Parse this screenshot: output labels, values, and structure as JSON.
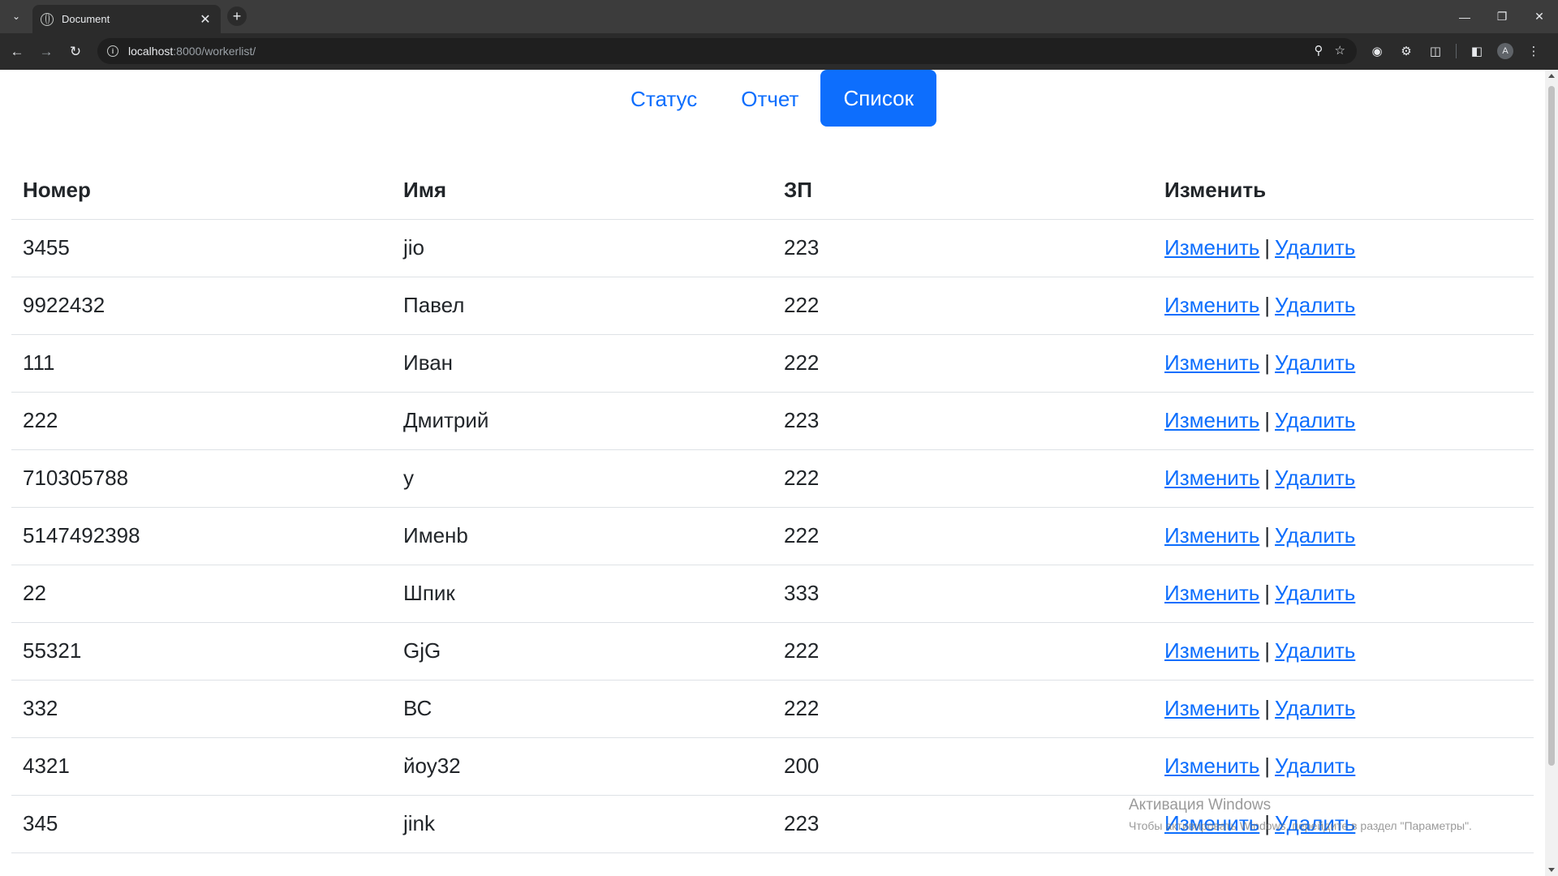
{
  "browser": {
    "tab_title": "Document",
    "url_host": "localhost",
    "url_rest": ":8000/workerlist/",
    "profile_initial": "A"
  },
  "nav": {
    "items": [
      {
        "label": "Статус",
        "active": false
      },
      {
        "label": "Отчет",
        "active": false
      },
      {
        "label": "Список",
        "active": true
      }
    ]
  },
  "table": {
    "headers": [
      "Номер",
      "Имя",
      "ЗП",
      "Изменить"
    ],
    "edit_label": "Изменить",
    "delete_label": "Удалить",
    "separator": "|",
    "rows": [
      {
        "id": "3455",
        "name": "jio",
        "salary": "223"
      },
      {
        "id": "9922432",
        "name": "Павел",
        "salary": "222"
      },
      {
        "id": "111",
        "name": "Иван",
        "salary": "222"
      },
      {
        "id": "222",
        "name": "Дмитрий",
        "salary": "223"
      },
      {
        "id": "710305788",
        "name": "у",
        "salary": "222"
      },
      {
        "id": "5147492398",
        "name": "Именb",
        "salary": "222"
      },
      {
        "id": "22",
        "name": "Шпик",
        "salary": "333"
      },
      {
        "id": "55321",
        "name": "GjG",
        "salary": "222"
      },
      {
        "id": "332",
        "name": "ВС",
        "salary": "222"
      },
      {
        "id": "4321",
        "name": "йоу32",
        "salary": "200"
      },
      {
        "id": "345",
        "name": "jink",
        "salary": "223"
      }
    ]
  },
  "watermark": {
    "title": "Активация Windows",
    "subtitle": "Чтобы активировать Windows, перейдите в раздел \"Параметры\"."
  }
}
